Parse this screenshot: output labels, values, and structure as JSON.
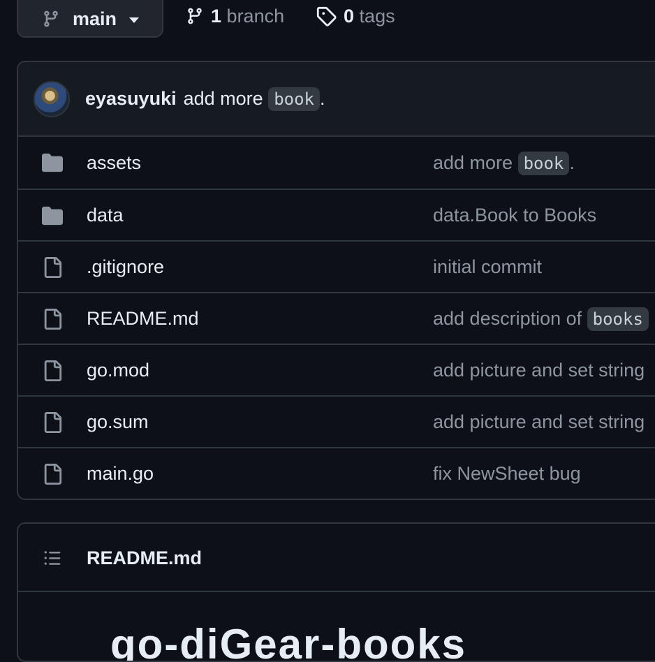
{
  "branch_selector": {
    "label": "main",
    "icon": "git-branch-icon"
  },
  "branches": {
    "count": "1",
    "label": "branch"
  },
  "tags": {
    "count": "0",
    "label": "tags"
  },
  "latest_commit": {
    "author": "eyasuyuki",
    "message_prefix": "add more",
    "message_code": "book",
    "message_suffix": "."
  },
  "files": [
    {
      "type": "folder",
      "name": "assets",
      "commit_prefix": "add more ",
      "commit_code": "book",
      "commit_suffix": "."
    },
    {
      "type": "folder",
      "name": "data",
      "commit_prefix": "data.Book to Books",
      "commit_code": "",
      "commit_suffix": ""
    },
    {
      "type": "file",
      "name": ".gitignore",
      "commit_prefix": "initial commit",
      "commit_code": "",
      "commit_suffix": ""
    },
    {
      "type": "file",
      "name": "README.md",
      "commit_prefix": "add description of ",
      "commit_code": "books",
      "commit_suffix": ""
    },
    {
      "type": "file",
      "name": "go.mod",
      "commit_prefix": "add picture and set string",
      "commit_code": "",
      "commit_suffix": ""
    },
    {
      "type": "file",
      "name": "go.sum",
      "commit_prefix": "add picture and set string",
      "commit_code": "",
      "commit_suffix": ""
    },
    {
      "type": "file",
      "name": "main.go",
      "commit_prefix": "fix NewSheet bug",
      "commit_code": "",
      "commit_suffix": ""
    }
  ],
  "readme": {
    "title": "README.md",
    "heading_peek": "go-diGear-books",
    "icon": "list-unordered-icon"
  },
  "colors": {
    "background": "#0d1117",
    "border": "#30363d",
    "muted": "#8d96a0",
    "folder": "#8d96a0"
  }
}
